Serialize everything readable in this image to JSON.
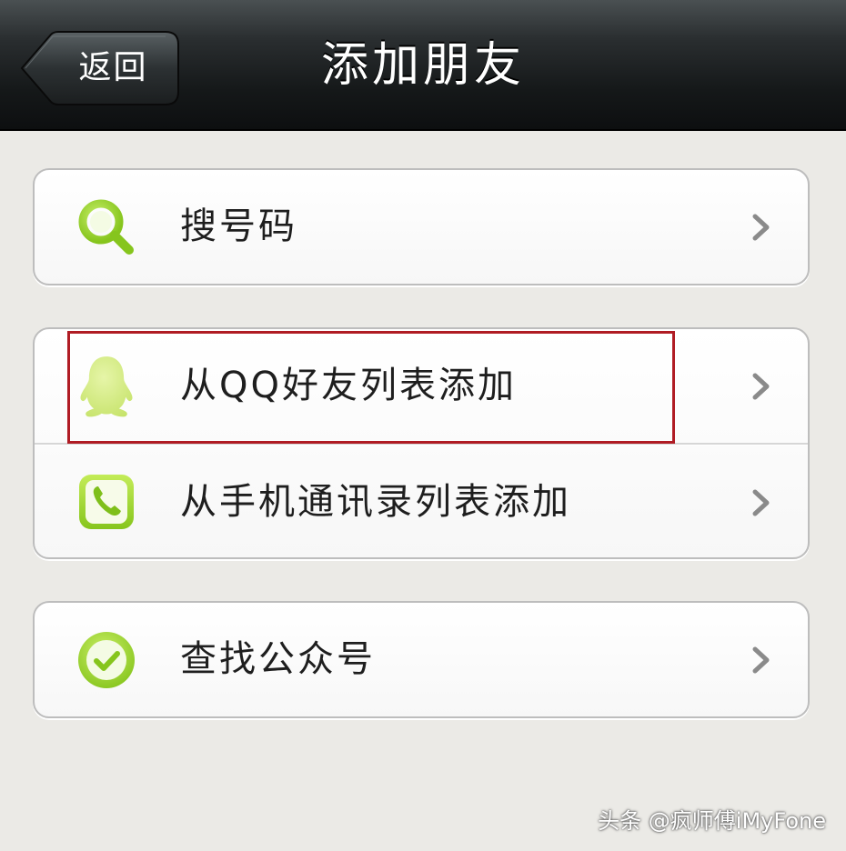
{
  "navbar": {
    "back_label": "返回",
    "title": "添加朋友"
  },
  "items": [
    {
      "label": "搜号码",
      "icon": "search-icon"
    },
    {
      "label": "从QQ好友列表添加",
      "icon": "qq-penguin-icon"
    },
    {
      "label": "从手机通讯录列表添加",
      "icon": "phone-icon"
    },
    {
      "label": "查找公众号",
      "icon": "checkmark-icon"
    }
  ],
  "watermark": "头条 @疯师傅iMyFone",
  "colors": {
    "navbar_bg": "#1a1d1e",
    "icon_green": "#8fd12a",
    "highlight_border": "#b01c24",
    "page_bg": "#ebeae6"
  }
}
